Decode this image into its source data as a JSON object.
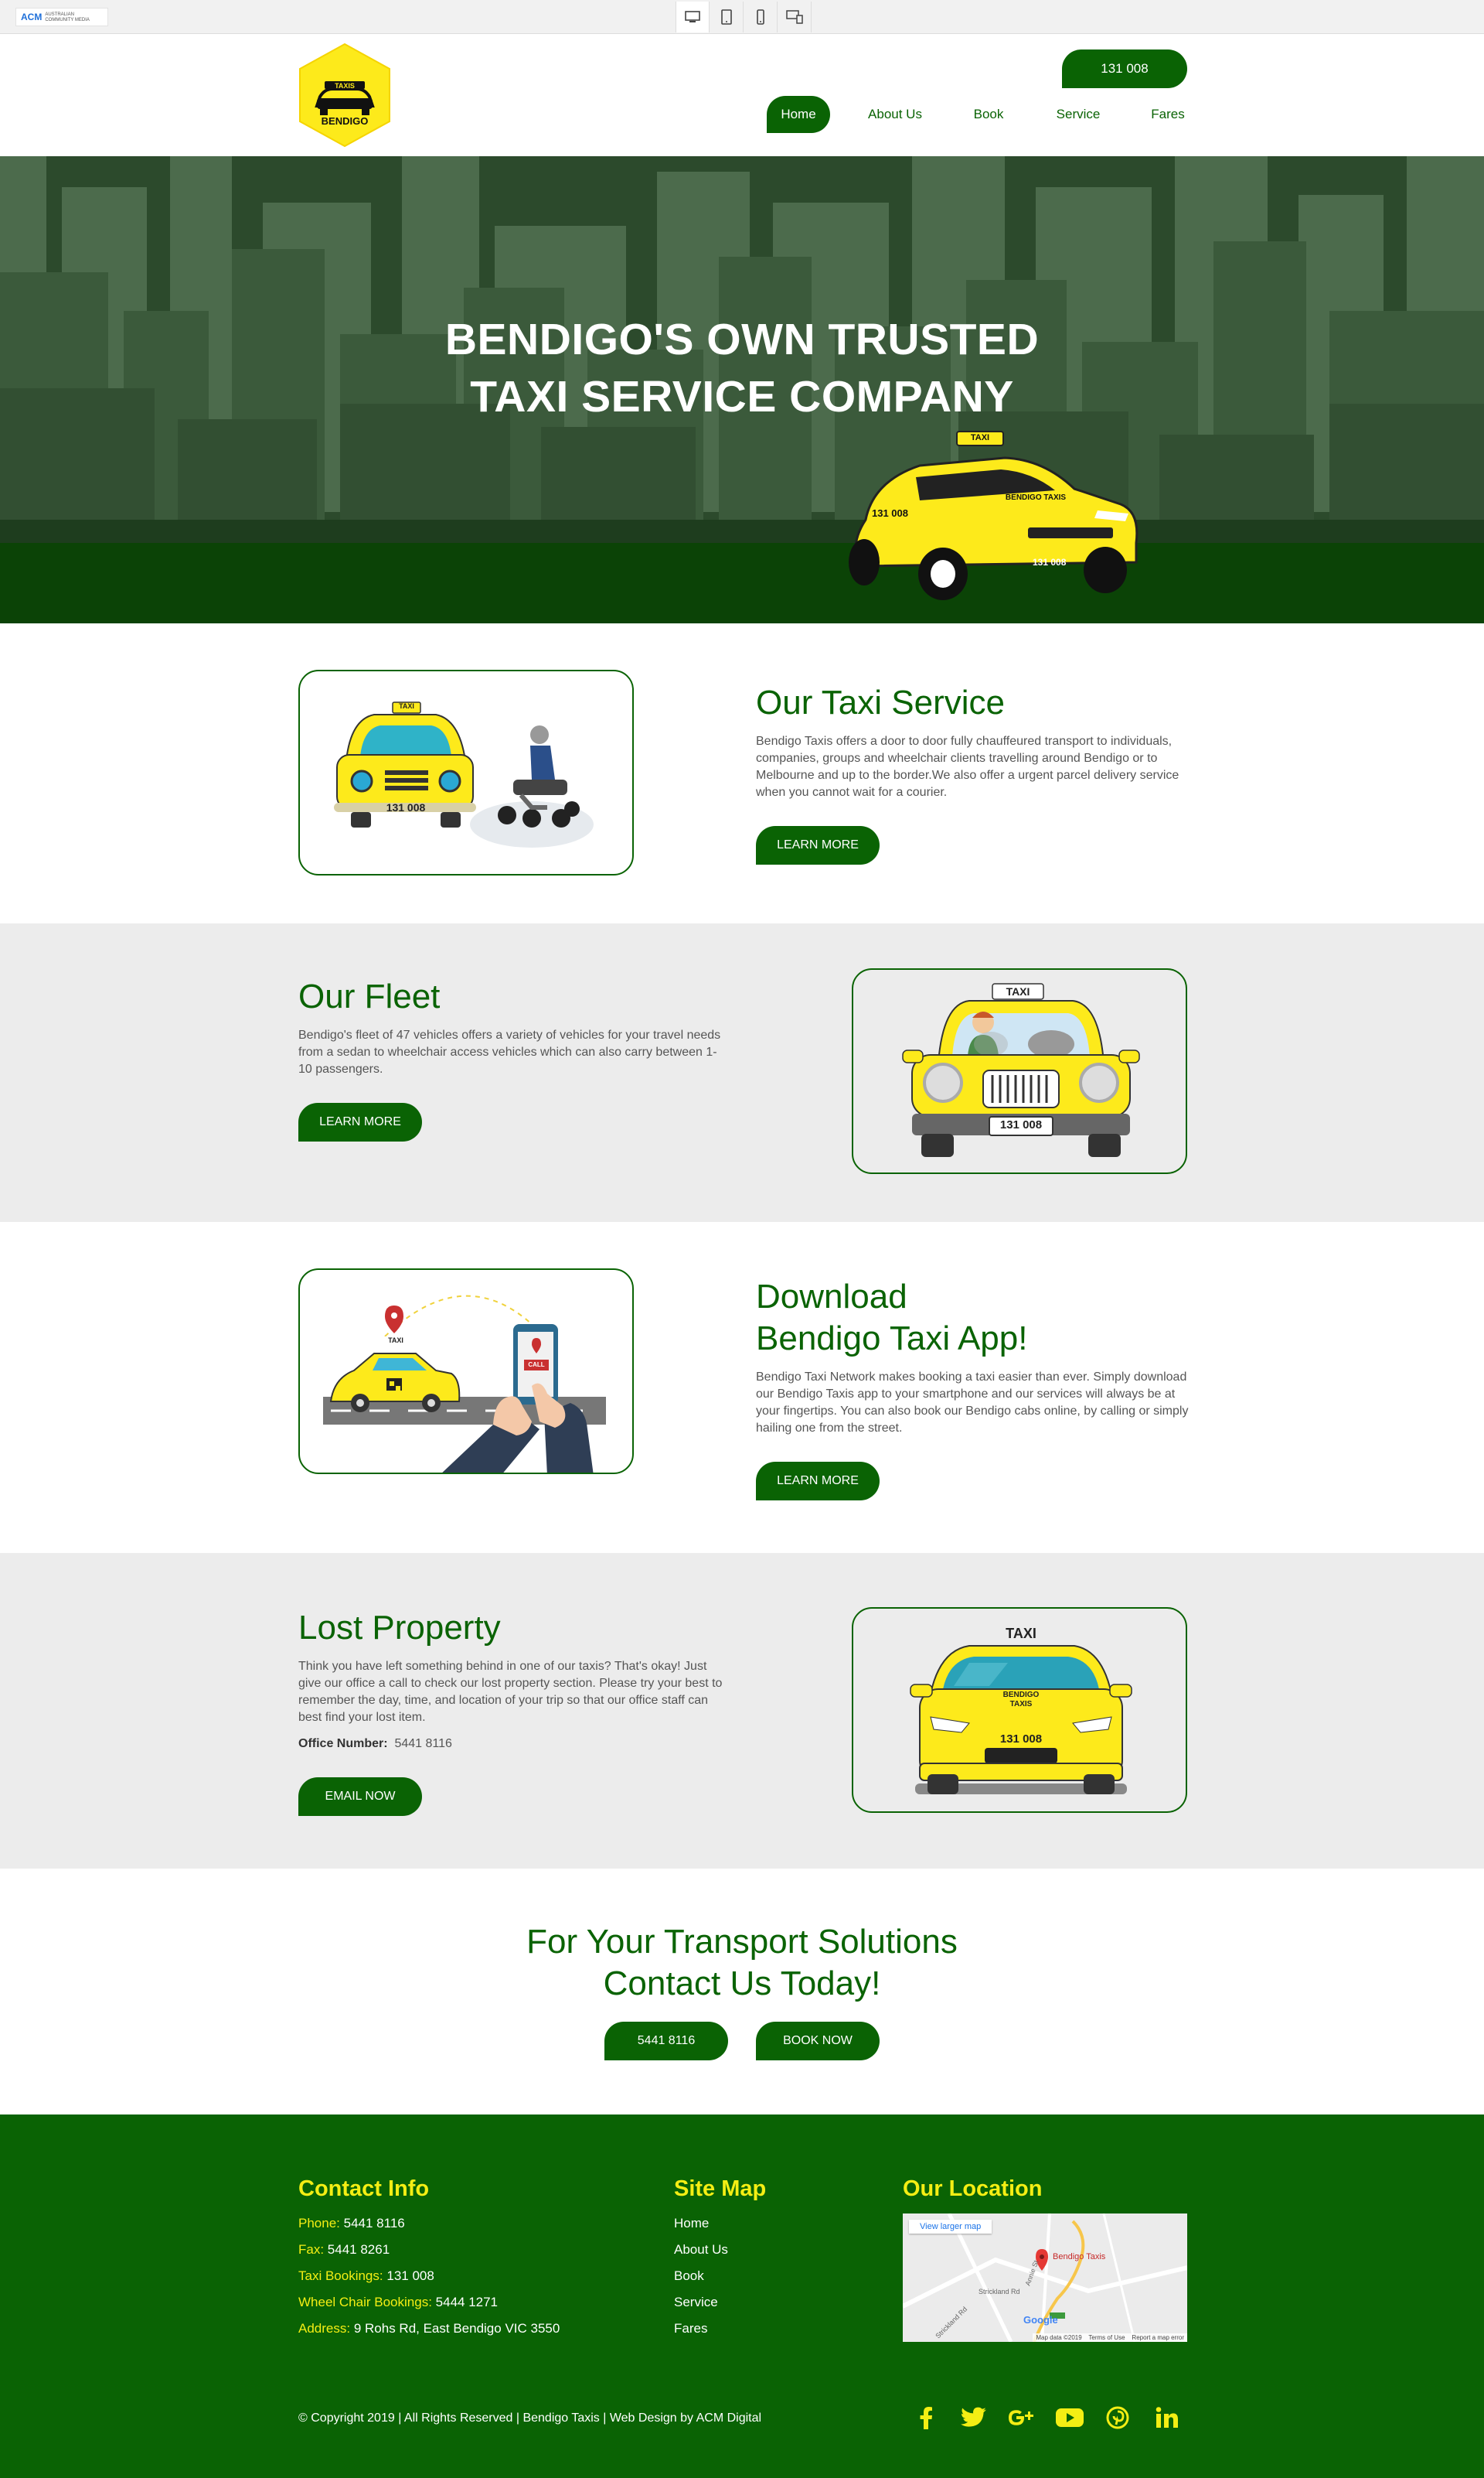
{
  "topbar": {
    "brand": "ACM",
    "brand_sub": "AUSTRALIAN COMMUNITY MEDIA",
    "devices": [
      "desktop-icon",
      "tablet-icon",
      "mobile-icon",
      "responsive-icon"
    ]
  },
  "header": {
    "logo_top": "TAXIS",
    "logo_bottom": "BENDIGO",
    "phone": "131 008",
    "nav": [
      "Home",
      "About Us",
      "Book",
      "Service",
      "Fares"
    ],
    "active_nav": "Home"
  },
  "hero": {
    "line1": "BENDIGO'S OWN TRUSTED",
    "line2": "TAXI SERVICE COMPANY",
    "taxi_sign": "TAXI",
    "taxi_number": "131 008",
    "taxi_brand": "BENDIGO TAXIS"
  },
  "service": {
    "title": "Our Taxi Service",
    "body": "Bendigo Taxis offers a door to door fully chauffeured transport to individuals, companies, groups and wheelchair clients travelling around Bendigo or to Melbourne and up to the border.We also offer a urgent parcel delivery service when you cannot wait for a courier.",
    "button": "LEARN MORE",
    "img_sign": "TAXI",
    "img_plate": "131 008"
  },
  "fleet": {
    "title": "Our Fleet",
    "body": "Bendigo's fleet of 47 vehicles offers a variety of vehicles for your travel needs from a sedan to wheelchair access vehicles which can also carry between 1-10 passengers.",
    "button": "LEARN MORE",
    "img_sign": "TAXI",
    "img_plate": "131 008"
  },
  "app": {
    "title1": "Download",
    "title2": "Bendigo Taxi App!",
    "body": "Bendigo Taxi Network makes booking a taxi easier than ever. Simply download our Bendigo Taxis app to your smartphone and our services will always be at your fingertips. You can also book our Bendigo cabs online, by calling or simply hailing one from the street.",
    "button": "LEARN MORE",
    "img_sign": "TAXI",
    "img_call": "CALL"
  },
  "lost": {
    "title": "Lost Property",
    "body": "Think you have left something behind in one of our taxis? That's okay! Just give our office a call to check our lost property section. Please try your best to remember the day, time, and location of your trip so that our office staff can best find your lost item.",
    "office_label": "Office Number:",
    "office_number": "5441 8116",
    "button": "EMAIL NOW",
    "img_sign": "TAXI",
    "img_brand": "BENDIGO TAXIS",
    "img_plate": "131 008"
  },
  "contact": {
    "line1": "For Your Transport Solutions",
    "line2": "Contact Us Today!",
    "phone_button": "5441 8116",
    "book_button": "BOOK NOW"
  },
  "footer": {
    "contact_title": "Contact Info",
    "contacts": [
      {
        "k": "Phone:",
        "v": "5441 8116"
      },
      {
        "k": "Fax:",
        "v": "5441 8261"
      },
      {
        "k": "Taxi Bookings:",
        "v": "131 008"
      },
      {
        "k": "Wheel Chair Bookings:",
        "v": "5444 1271"
      },
      {
        "k": "Address:",
        "v": "9 Rohs Rd, East Bendigo VIC 3550"
      }
    ],
    "sitemap_title": "Site Map",
    "sitemap": [
      "Home",
      "About Us",
      "Book",
      "Service",
      "Fares"
    ],
    "location_title": "Our Location",
    "map": {
      "link": "View larger map",
      "pin": "Bendigo Taxis",
      "road1": "Strickland Rd",
      "road2": "Annie St",
      "road3": "Strickland Rd",
      "google": "Google",
      "credits": "Map data ©2019    Terms of Use    Report a map error"
    },
    "copyright": "© Copyright 2019 | All Rights Reserved | Bendigo Taxis | Web Design by ACM Digital",
    "social": [
      "facebook-icon",
      "twitter-icon",
      "google-plus-icon",
      "youtube-icon",
      "pinterest-icon",
      "linkedin-icon"
    ],
    "accent": "#f4ee14",
    "bg": "#0a6304"
  }
}
